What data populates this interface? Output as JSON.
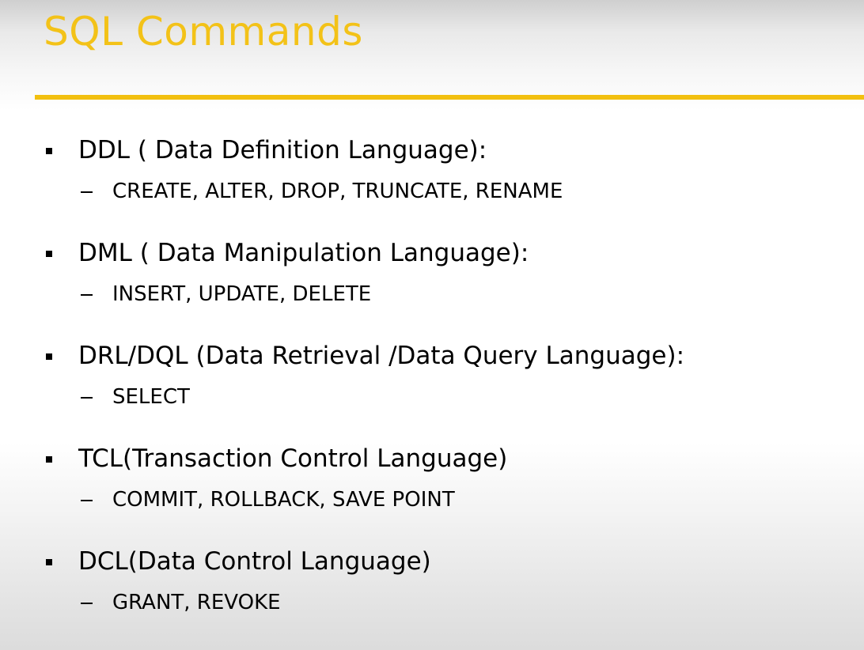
{
  "slide": {
    "title": "SQL Commands",
    "colors": {
      "title": "#f3c218",
      "rule": "#f2c010",
      "text": "#000000"
    },
    "items": [
      {
        "label": "DDL ( Data Definition Language):",
        "sub": "CREATE, ALTER, DROP, TRUNCATE, RENAME"
      },
      {
        "label": "DML ( Data Manipulation Language):",
        "sub": "INSERT, UPDATE, DELETE"
      },
      {
        "label": "DRL/DQL (Data Retrieval /Data Query Language):",
        "sub": "SELECT"
      },
      {
        "label": "TCL(Transaction Control Language)",
        "sub": "COMMIT, ROLLBACK, SAVE POINT"
      },
      {
        "label": "DCL(Data Control Language)",
        "sub": "GRANT, REVOKE"
      }
    ]
  }
}
